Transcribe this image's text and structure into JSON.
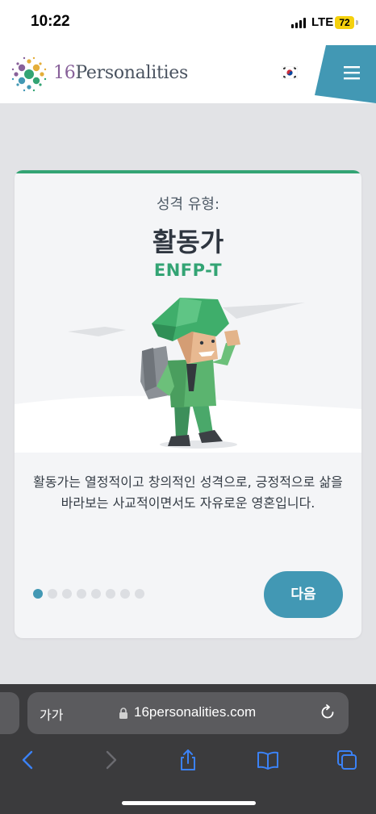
{
  "status": {
    "time": "10:22",
    "network": "LTE",
    "battery": "72"
  },
  "header": {
    "brand_prefix": "16",
    "brand_name": "Personalities",
    "language_flag": "korea-flag-icon",
    "menu_icon": "hamburger-menu-icon"
  },
  "card": {
    "kicker": "성격 유형:",
    "title": "활동가",
    "code": "ENFP-T",
    "description": "활동가는 열정적이고 창의적인 성격으로, 긍정적으로 삶을 바라보는 사교적이면서도 자유로운 영혼입니다.",
    "next_label": "다음",
    "pagination": {
      "total": 8,
      "active": 1
    }
  },
  "browser": {
    "text_size_label": "가가",
    "url": "16personalities.com",
    "toolbar": [
      "back-icon",
      "forward-icon",
      "share-icon",
      "bookmarks-icon",
      "tabs-icon"
    ]
  },
  "colors": {
    "accent_green": "#33a474",
    "accent_blue": "#4298b4",
    "menu_blue": "#4298b4"
  }
}
